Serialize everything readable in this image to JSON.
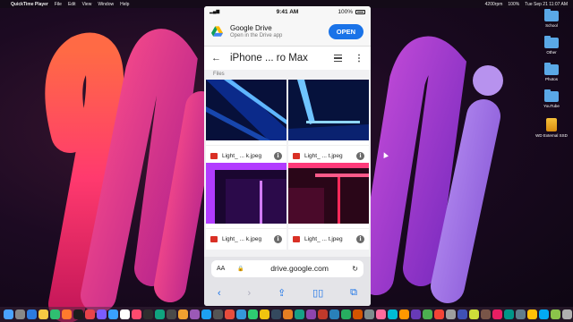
{
  "menubar": {
    "app_name": "QuickTime Player",
    "items": [
      "File",
      "Edit",
      "View",
      "Window",
      "Help"
    ],
    "status": [
      "4200rpm",
      "100%",
      "Tue Sep 21 11:07 AM"
    ]
  },
  "desktop": {
    "icons": [
      {
        "label": "School",
        "icon": "folder-icon"
      },
      {
        "label": "Other",
        "icon": "folder-icon"
      },
      {
        "label": "Photos",
        "icon": "folder-icon"
      },
      {
        "label": "YouTube",
        "icon": "folder-icon"
      },
      {
        "label": "WD External SSD",
        "icon": "external-drive-icon"
      }
    ]
  },
  "phone": {
    "status": {
      "time": "9:41 AM",
      "battery": "100%"
    },
    "banner": {
      "app_name": "Google Drive",
      "subtitle": "Open in the Drive app",
      "open_label": "OPEN"
    },
    "appbar": {
      "title": "iPhone ... ro Max"
    },
    "files_label": "Files",
    "files": [
      {
        "name": "Light_ ... k.jpeg"
      },
      {
        "name": "Light_ ... t.jpeg"
      },
      {
        "name": "Light_ ... k.jpeg"
      },
      {
        "name": "Light_ ... t.jpeg"
      }
    ],
    "urlbar": {
      "aa": "AA",
      "url": "drive.google.com"
    }
  },
  "colors": {
    "accent": "#1a73e8",
    "image_icon": "#d93025"
  }
}
